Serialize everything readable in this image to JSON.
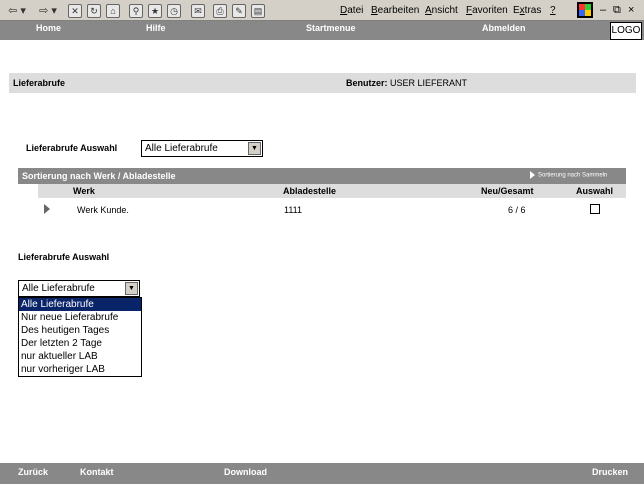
{
  "browser": {
    "menu": [
      {
        "pre": "",
        "u": "D",
        "post": "atei"
      },
      {
        "pre": "",
        "u": "B",
        "post": "earbeiten"
      },
      {
        "pre": "",
        "u": "A",
        "post": "nsicht"
      },
      {
        "pre": "",
        "u": "F",
        "post": "avoriten"
      },
      {
        "pre": "E",
        "u": "x",
        "post": "tras"
      },
      {
        "pre": "",
        "u": "?",
        "post": ""
      }
    ],
    "window_controls": {
      "minimize": "–",
      "restore": "⧉",
      "close": "×"
    }
  },
  "topnav": {
    "home": "Home",
    "hilfe": "Hilfe",
    "startmenue": "Startmenue",
    "abmelden": "Abmelden"
  },
  "logo": "LOGO",
  "header": {
    "title": "Lieferabrufe",
    "user_label": "Benutzer:",
    "user_value": "USER LIEFERANT"
  },
  "auswahl1": {
    "label": "Lieferabrufe Auswahl",
    "value": "Alle Lieferabrufe"
  },
  "sortbar": {
    "left": "Sortierung nach Werk / Abladestelle",
    "right": "Sortierung nach Sammeln"
  },
  "table": {
    "headers": {
      "werk": "Werk",
      "abladestelle": "Abladestelle",
      "neu_gesamt": "Neu/Gesamt",
      "auswahl": "Auswahl"
    },
    "rows": [
      {
        "werk": "Werk Kunde.",
        "abladestelle": "1111",
        "neu_gesamt": "6 / 6",
        "checked": false
      }
    ]
  },
  "auswahl2": {
    "label": "Lieferabrufe Auswahl",
    "value": "Alle Lieferabrufe",
    "options": [
      "Alle Lieferabrufe",
      "Nur neue Lieferabrufe",
      "Des heutigen Tages",
      "Der letzten 2 Tage",
      "nur aktueller LAB",
      "nur vorheriger LAB"
    ],
    "highlighted_index": 0
  },
  "botnav": {
    "zurueck": "Zurück",
    "kontakt": "Kontakt",
    "download": "Download",
    "drucken": "Drucken"
  }
}
